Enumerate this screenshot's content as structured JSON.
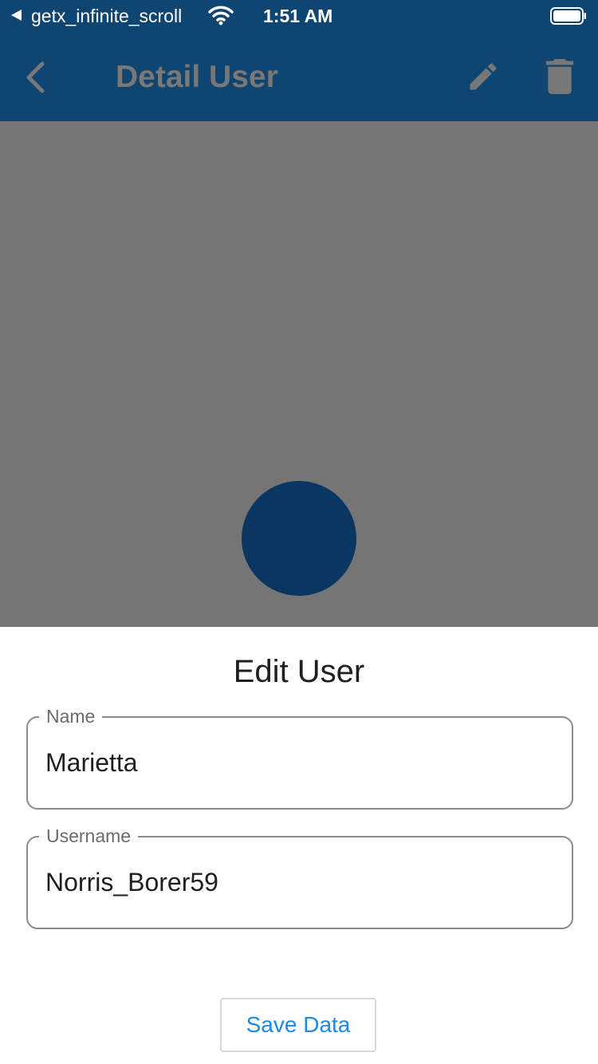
{
  "status_bar": {
    "back_app_name": "getx_infinite_scroll",
    "time": "1:51 AM",
    "wifi_icon": "wifi-icon",
    "battery_icon": "battery-icon"
  },
  "app_bar": {
    "title": "Detail User",
    "back_icon": "chevron-left-icon",
    "edit_icon": "pencil-icon",
    "delete_icon": "trash-icon",
    "background_color": "#0e4571",
    "title_color": "#787878"
  },
  "content": {
    "scrim_color": "#757575",
    "avatar_color": "#0a3662"
  },
  "bottom_sheet": {
    "title": "Edit User",
    "fields": [
      {
        "label": "Name",
        "value": "Marietta"
      },
      {
        "label": "Username",
        "value": "Norris_Borer59"
      }
    ],
    "save_button_label": "Save Data",
    "accent_color": "#1e88e5"
  }
}
